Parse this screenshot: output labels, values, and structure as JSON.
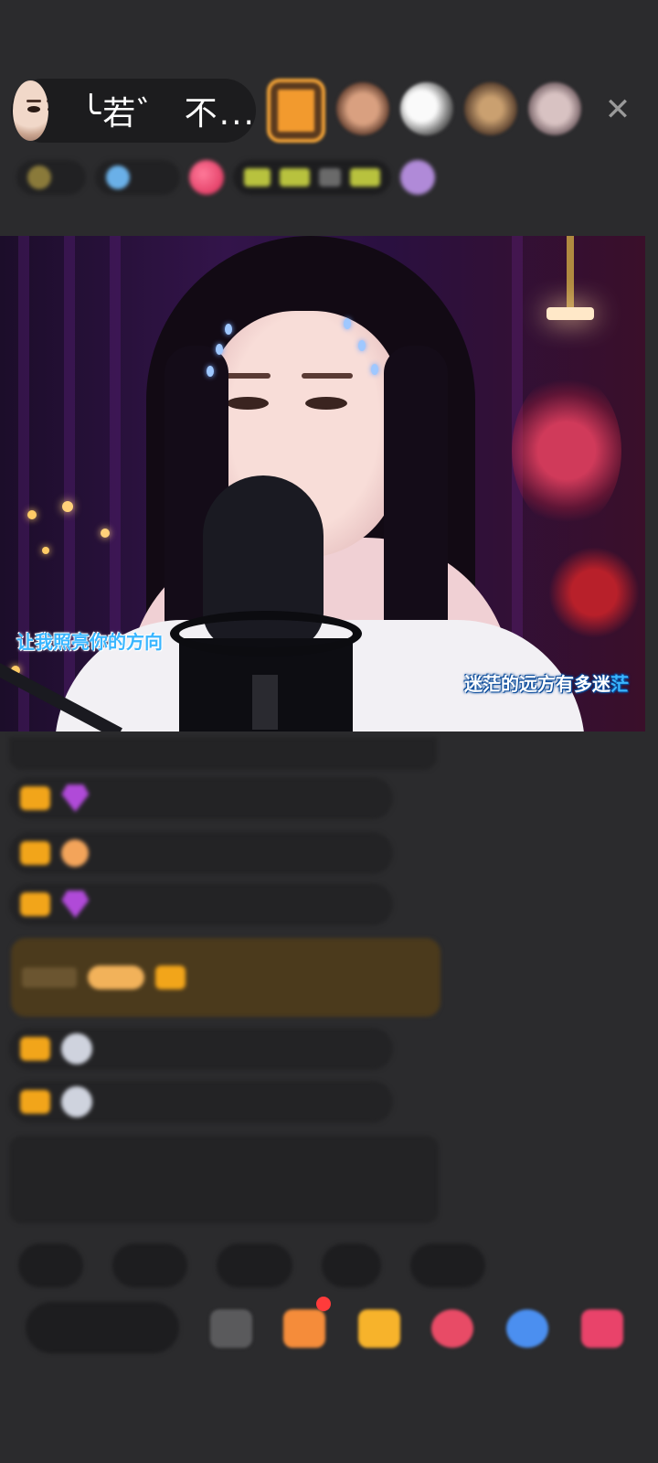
{
  "host": {
    "name": "╰若゛ 不..."
  },
  "viewers": [
    "viewer-1",
    "viewer-2",
    "viewer-3",
    "viewer-4",
    "viewer-5"
  ],
  "close_icon": "close-icon",
  "video": {
    "lyric_left": "让我照亮你的方向",
    "lyric_right_main": "迷茫的远方有多迷",
    "lyric_right_tail": "茫"
  },
  "colors": {
    "badge": "#f2a51a",
    "lyric_highlight": "#3ab6ff",
    "notice_text": "#a6d36a"
  }
}
